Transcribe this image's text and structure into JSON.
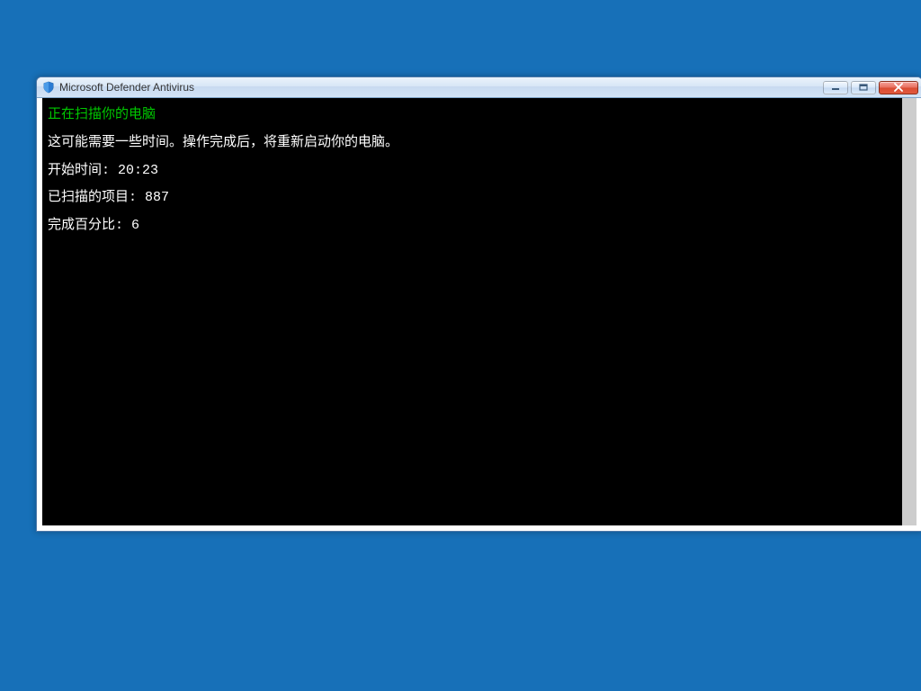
{
  "window": {
    "title": "Microsoft Defender Antivirus"
  },
  "console": {
    "heading": "正在扫描你的电脑",
    "description": "这可能需要一些时间。操作完成后，将重新启动你的电脑。",
    "start_time_label": "开始时间:",
    "start_time_value": "20:23",
    "scanned_label": "已扫描的项目:",
    "scanned_value": "887",
    "percent_label": "完成百分比:",
    "percent_value": "6"
  }
}
